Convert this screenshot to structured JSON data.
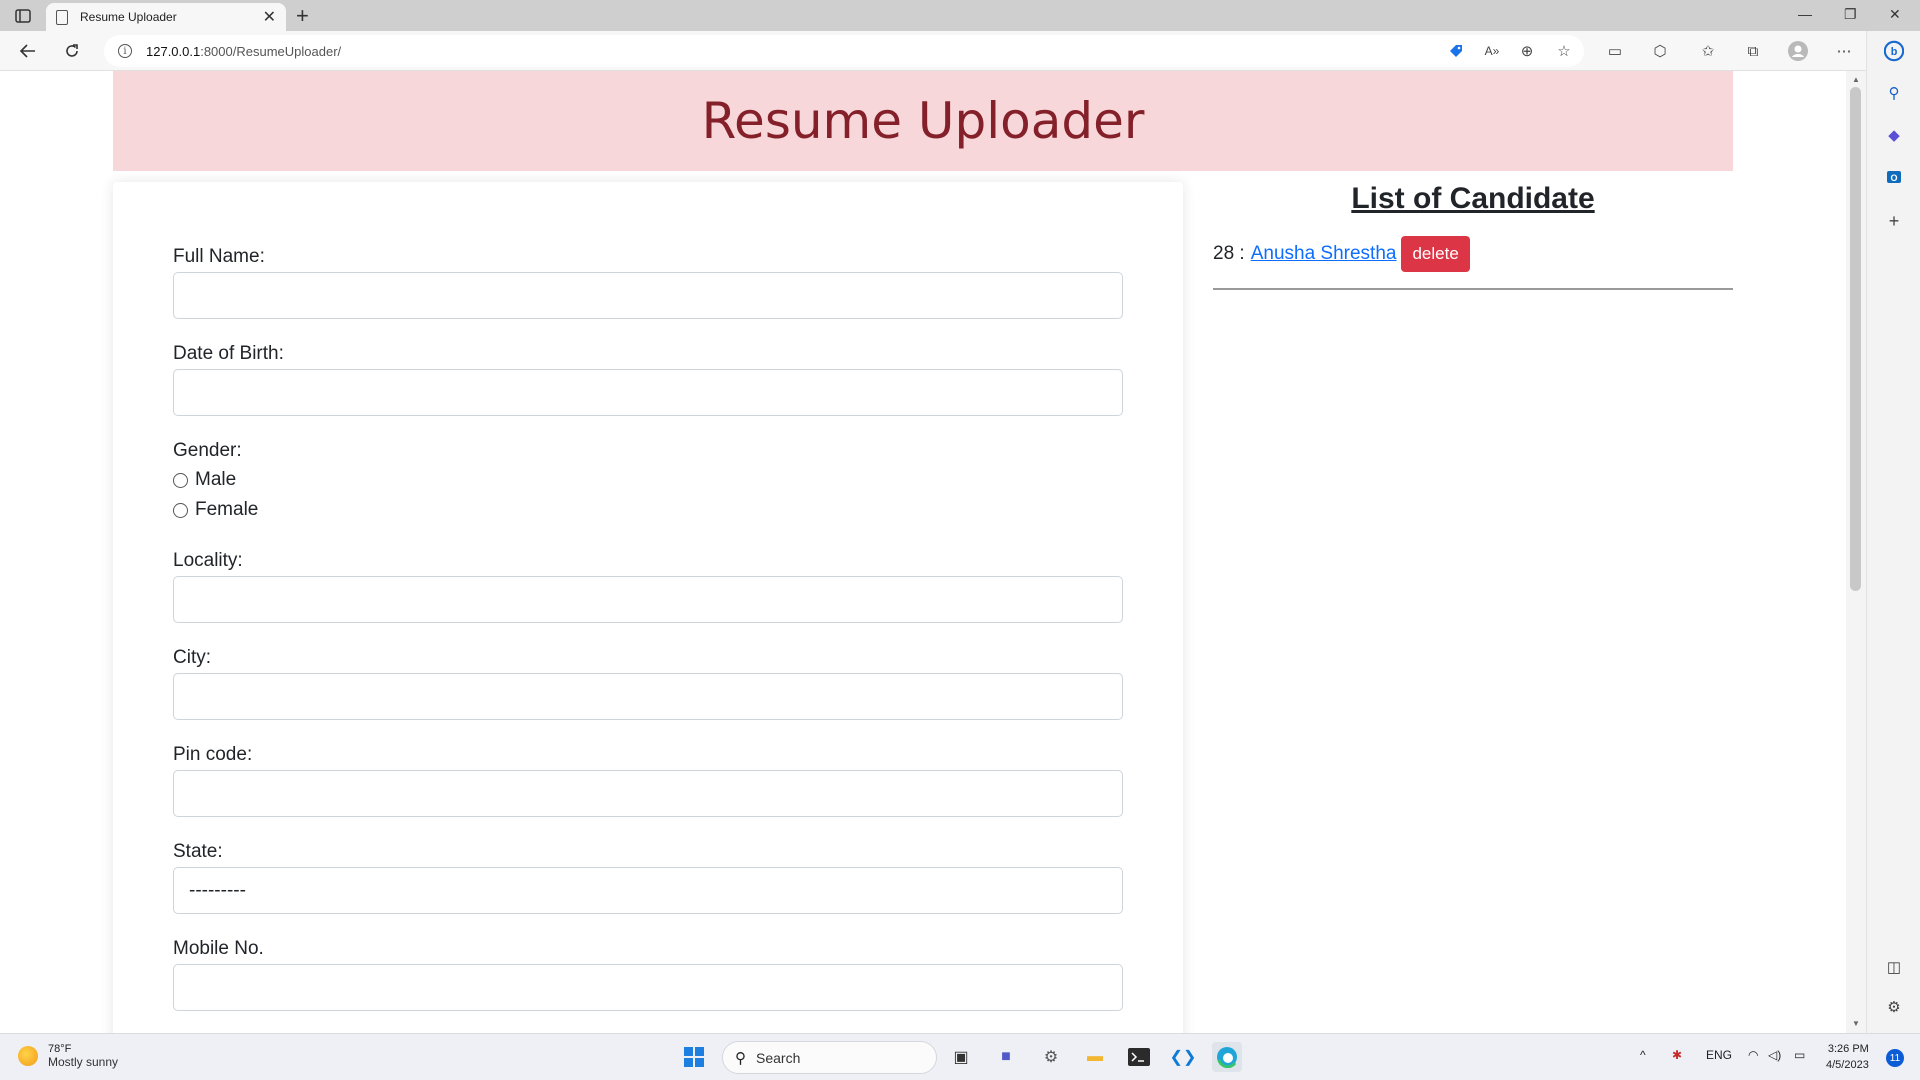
{
  "browser": {
    "tab_title": "Resume Uploader",
    "tab_close": "✕",
    "new_tab": "+",
    "url_host": "127.0.0.1",
    "url_rest": ":8000/ResumeUploader/",
    "info_glyph": "i",
    "window_controls": [
      "—",
      "❐",
      "✕"
    ]
  },
  "page": {
    "heading": "Resume Uploader",
    "form": {
      "full_name_label": "Full Name:",
      "dob_label": "Date of Birth:",
      "gender_label": "Gender:",
      "gender_options": [
        "Male",
        "Female"
      ],
      "locality_label": "Locality:",
      "city_label": "City:",
      "pincode_label": "Pin code:",
      "state_label": "State:",
      "state_selected": "---------",
      "mobile_label": "Mobile No."
    },
    "candidates": {
      "title": "List of Candidate",
      "items": [
        {
          "id_text": "28 :",
          "name": "Anusha Shrestha",
          "delete_label": "delete"
        }
      ]
    }
  },
  "taskbar": {
    "temperature": "78°F",
    "weather": "Mostly sunny",
    "search_label": "Search",
    "lang": "ENG",
    "time": "3:26 PM",
    "date": "4/5/2023",
    "notification_count": "11"
  },
  "colors": {
    "header_bg": "#f8d7da",
    "header_text": "#842029",
    "link": "#0d6efd",
    "delete_button": "#dc3545"
  }
}
